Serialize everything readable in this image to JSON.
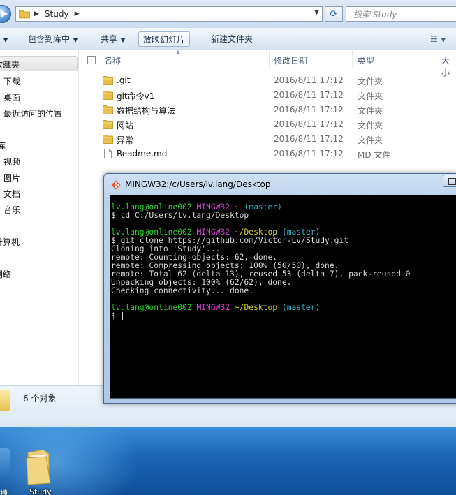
{
  "address_bar": {
    "path": "Study",
    "search_placeholder": "搜索 Study"
  },
  "toolbar": {
    "include_in_library": "包含到库中",
    "share": "共享",
    "slideshow": "放映幻灯片",
    "new_folder": "新建文件夹"
  },
  "nav_pane": {
    "favorites": "收藏夹",
    "favorites_items": [
      "下载",
      "桌面",
      "最近访问的位置"
    ],
    "libraries": "库",
    "library_items": [
      "视频",
      "图片",
      "文档",
      "音乐"
    ],
    "computer": "计算机",
    "network": "网络"
  },
  "columns": {
    "name": "名称",
    "date_modified": "修改日期",
    "type": "类型",
    "size": "大小"
  },
  "files": [
    {
      "name": ".git",
      "date": "2016/8/11 17:12",
      "type": "文件夹",
      "icon": "folder-icon"
    },
    {
      "name": "git命令v1",
      "date": "2016/8/11 17:12",
      "type": "文件夹",
      "icon": "folder-icon"
    },
    {
      "name": "数据结构与算法",
      "date": "2016/8/11 17:12",
      "type": "文件夹",
      "icon": "folder-icon"
    },
    {
      "name": "网站",
      "date": "2016/8/11 17:12",
      "type": "文件夹",
      "icon": "folder-icon"
    },
    {
      "name": "异常",
      "date": "2016/8/11 17:12",
      "type": "文件夹",
      "icon": "folder-icon"
    },
    {
      "name": "Readme.md",
      "date": "2016/8/11 17:12",
      "type": "MD 文件",
      "icon": "document-icon"
    }
  ],
  "details": {
    "count": "6 个对象"
  },
  "terminal": {
    "title": "MINGW32:/c/Users/lv.lang/Desktop",
    "blocks": [
      {
        "user": "lv.lang@online002",
        "env": "MINGW32",
        "path": "~",
        "branch": "(master)",
        "command": "$ cd C:/Users/lv.lang/Desktop",
        "output": []
      },
      {
        "user": "lv.lang@online002",
        "env": "MINGW32",
        "path": "~/Desktop",
        "branch": "(master)",
        "command": "$ git clone https://github.com/Victor-Lv/Study.git",
        "output": [
          "Cloning into 'Study'...",
          "remote: Counting objects: 62, done.",
          "remote: Compressing objects: 100% (50/50), done.",
          "remote: Total 62 (delta 13), reused 53 (delta 7), pack-reused 0",
          "Unpacking objects: 100% (62/62), done.",
          "Checking connectivity... done."
        ]
      },
      {
        "user": "lv.lang@online002",
        "env": "MINGW32",
        "path": "~/Desktop",
        "branch": "(master)",
        "command": "$ ",
        "output": []
      }
    ],
    "colors": {
      "user": "#2fd12f",
      "env": "#d23cd2",
      "path": "#cfcf2b",
      "branch": "#2fb7cf"
    }
  },
  "desktop": {
    "left_icon_label": "捷",
    "folder_label": "Study"
  }
}
